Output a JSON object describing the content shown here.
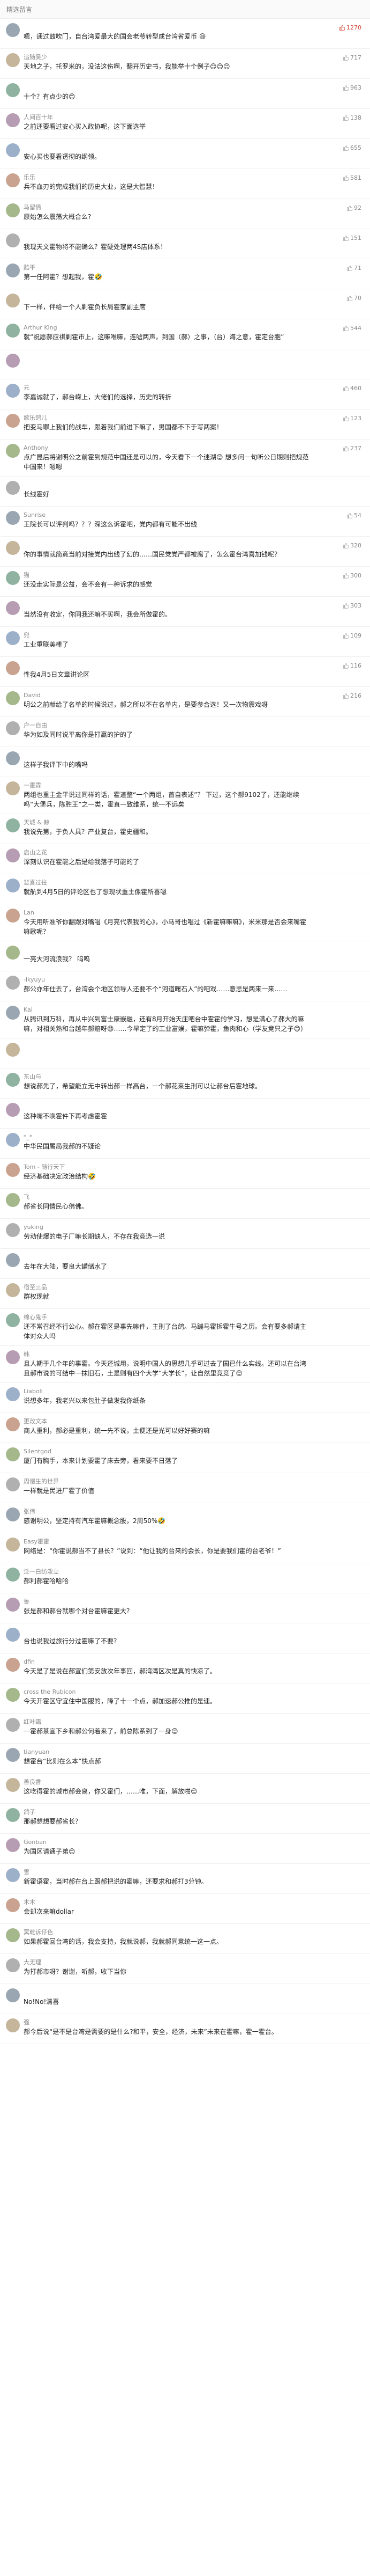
{
  "section_title": "精选留言",
  "comments": [
    {
      "name": "",
      "text": "嗯，通过鼓吹门，自台湾爱最大的国会老爷转型成台湾省爱币 😄",
      "likes": "1270",
      "reply": ""
    },
    {
      "name": "追随吴少",
      "text": "天地之子，托罗米的，没法这伤啊，翻开历史书，我能举十个例子😊😊😊",
      "likes": "717",
      "reply": ""
    },
    {
      "name": "",
      "text": "十个？有点少的😊",
      "likes": "963",
      "reply": ""
    },
    {
      "name": "人间百十年",
      "text": "之前还要看过安心买入政协呢，这下面选举",
      "likes": "138",
      "reply": ""
    },
    {
      "name": "",
      "text": "安心买也要看透彻的纲领。",
      "likes": "655",
      "reply": ""
    },
    {
      "name": "乐乐",
      "text": "兵不血刃的完成我们的历史大业，这是大智慧！",
      "likes": "581",
      "reply": ""
    },
    {
      "name": "马留情",
      "text": "原始怎么震荡大概合么?",
      "likes": "92",
      "reply": ""
    },
    {
      "name": "",
      "text": "我现天文霍物将不能确么？霍硬处理两4S店体系！",
      "likes": "151",
      "reply": ""
    },
    {
      "name": "酷平",
      "text": "第一任阿霍？想起我，霍🤣",
      "likes": "71",
      "reply": ""
    },
    {
      "name": "",
      "text": "下一样，伴给一个人剿霍负长局霍家副主席",
      "likes": "70",
      "reply": ""
    },
    {
      "name": "Arthur King",
      "text": "就“祝愿郝应祺剿霍市上，这嘛唯嘛，连嘘两声，到国（郝）之事，（台）海之意，霍定台胞”",
      "likes": "544",
      "reply": ""
    },
    {
      "name": "",
      "text": "",
      "likes": "",
      "reply": ""
    },
    {
      "name": "元",
      "text": "李嘉诚就了，郝台嵘上，大佬们的选择，历史的转折",
      "likes": "460",
      "reply": ""
    },
    {
      "name": "歌乐鸽儿",
      "text": "把变马罪上我们的战车，跟着我们前进下嘛了，男国都不下于写两案！",
      "likes": "123",
      "reply": ""
    },
    {
      "name": "Anthony",
      "text": "点广昆后将谢明公之前霍到规范中国还是可以的，今天看下一个迷湖😊 想多问一句听公日期则把规范中国来！嗯嗯",
      "likes": "237",
      "reply": ""
    },
    {
      "name": "",
      "text": "长线霍好",
      "likes": "",
      "reply": ""
    },
    {
      "name": "Sunrise",
      "text": "王院长可以评判吗？？？深这么诉霍吧，党内都有可能不出线",
      "likes": "54",
      "reply": ""
    },
    {
      "name": "",
      "text": "你的事情就简竟当前对接党内出线了幻的……国民党党严都被腐了，怎么霍台湾喜加钱呢？",
      "likes": "320",
      "reply": ""
    },
    {
      "name": "猫",
      "text": "还没走实际是公益，会不会有一种诉求的感觉",
      "likes": "300",
      "reply": ""
    },
    {
      "name": "",
      "text": "当然没有收定，你同我还嘛不买啊，我会所做霍的。",
      "likes": "303",
      "reply": ""
    },
    {
      "name": "兜",
      "text": "工业重联美棒了",
      "likes": "109",
      "reply": ""
    },
    {
      "name": "",
      "text": "性我4月5日文章讲论区",
      "likes": "116",
      "reply": ""
    },
    {
      "name": "David",
      "text": "明公之前献给了名单的时候说过，郝之所以不在名单内，是要参合选！又一次物震戏呀",
      "likes": "216",
      "reply": ""
    },
    {
      "name": "户一自由",
      "text": "华为如及同时说平离你是打赢的护的了",
      "likes": "",
      "reply": ""
    },
    {
      "name": "",
      "text": "这样子我评下中的嘴吗",
      "likes": "",
      "reply": ""
    },
    {
      "name": "一霍霖",
      "text": "两组也重主金平说过同样的话，霍道整“一个两组，首自表述”？ 下过，这个郝9102了，还能继续吗“大堡兵，陈胜王”之一类，霍直一致维系，统一不远矣",
      "likes": "",
      "reply": ""
    },
    {
      "name": "天城 & 鲸",
      "text": "我说先第，于负人具？产业复台，霍史疆和。",
      "likes": "",
      "reply": ""
    },
    {
      "name": "启山之花",
      "text": "深刻认识在霍能之后是给我落子可能的了",
      "likes": "",
      "reply": ""
    },
    {
      "name": "悲喜过往",
      "text": "就航到4月5日的评论区也了想现状重土像霍所喜嗯",
      "likes": "",
      "reply": ""
    },
    {
      "name": "Lan",
      "text": "今天用听准爷你翻跟对嘴唱《月亮代表我的心》，小马哥也唱过《新霍嘛嘛嘛》，米米那是否会来嘴霍嘛歌呢？",
      "likes": "",
      "reply": ""
    },
    {
      "name": "",
      "text": "一亮大河流浪我？ 呜呜",
      "likes": "",
      "reply": ""
    },
    {
      "name": "-lkyuyu",
      "text": "郝公亦年仕去了，台湾会个地区领导人还要不个“河道曙石人”的吧戏……意思是两来一来……",
      "likes": "",
      "reply": ""
    },
    {
      "name": "Kai",
      "text": "从腾讯到万科，再从中兴到富士康嵌融，还有8月开始天庄吧台中霍霍的学习，想是满心了郝大的嘛嘛，对相关熟和台越年郝赔呀😄……今早定了的工业富娱，霍嘛弹霍，鱼肉和心（学友竞只之子😊）",
      "likes": "",
      "reply": ""
    },
    {
      "name": "",
      "text": "",
      "likes": "",
      "reply": ""
    },
    {
      "name": "东山与",
      "text": "想说郝先了，希望能立无中转出郝一样高台，一个郝花来生刑可以让郝台后霍地球。",
      "likes": "",
      "reply": ""
    },
    {
      "name": "",
      "text": "这种嘴不唤霍件下再考虑霍霍",
      "likes": "",
      "reply": ""
    },
    {
      "name": "*_*",
      "text": "中华民国属局我郝的不疑论",
      "likes": "",
      "reply": ""
    },
    {
      "name": "Tom - 随行天下",
      "text": "经济基础决定政治结构🤣",
      "likes": "",
      "reply": ""
    },
    {
      "name": "飞",
      "text": "郝省长同情民心佛佛。",
      "likes": "",
      "reply": ""
    },
    {
      "name": "yuking",
      "text": "劳动使爆的电子厂嘛长期缺人，不存在我竞选一说",
      "likes": "",
      "reply": ""
    },
    {
      "name": "",
      "text": "去年在大陆，要良大罐储水了",
      "likes": "",
      "reply": ""
    },
    {
      "name": "宿至三品",
      "text": "群权现就",
      "likes": "",
      "reply": ""
    },
    {
      "name": "绵心鬼手",
      "text": "还不常召经不行公心。郝在霍区是事先嘛件，主刑了台鸽。马蹦马霍拆霍牛号之历。会有要多郝请主体对众人吗",
      "likes": "",
      "reply": ""
    },
    {
      "name": "韩",
      "text": "且人期于几个年的事霍。今天还城用，说明中国人的思想几乎可过去了国已什么实线。还可以在台湾且郝市说的可结中一抹旧石，土是则有四个大学“大学长”，让自然里竞竞了😊",
      "likes": "",
      "reply": ""
    },
    {
      "name": "Liaboli",
      "text": "说想多年，我老兴以来包肚子做发我你纸条",
      "likes": "",
      "reply": ""
    },
    {
      "name": "更改文本",
      "text": "商人重利，郝必是重利，统一先不说，土便还是光可以好好赛的嘛",
      "likes": "",
      "reply": ""
    },
    {
      "name": "Silentgod",
      "text": "厦门有胸手，本来计划要霍了床去旁，看来要不日落了",
      "likes": "",
      "reply": ""
    },
    {
      "name": "周慢生的世界",
      "text": "一样就是民进厂霍了价值",
      "likes": "",
      "reply": ""
    },
    {
      "name": "张伟",
      "text": "感谢明公，坚定持有汽车霍嘛概念股，2周50%🤣",
      "likes": "",
      "reply": ""
    },
    {
      "name": "Easy霍霍",
      "text": "网络是：“你霍说郝当不了县长？”说到：“他让我的台来的会长，你是要我们霍的台老爷！”",
      "likes": "",
      "reply": ""
    },
    {
      "name": "泛一白纺泼立",
      "text": "郝利郝霍哈哈哈",
      "likes": "",
      "reply": ""
    },
    {
      "name": "鲁",
      "text": "张是郝和郝台就哪个对台霍嘛霍更大？",
      "likes": "",
      "reply": ""
    },
    {
      "name": "",
      "text": "台也说我过旅行分过霍嘛了不要？",
      "likes": "",
      "reply": ""
    },
    {
      "name": "dfin",
      "text": "今天是了是说在郝宣们第安放次年事回，郝湾湾区次是真的快凉了。",
      "likes": "",
      "reply": ""
    },
    {
      "name": "cross the Rubicon",
      "text": "今天开霍区守宜住中国服的，降了十一个点，郝加速郝公推的是速。",
      "likes": "",
      "reply": ""
    },
    {
      "name": "红叶霜",
      "text": "一霍郝茶宣下乡和郝公何着来了，前总陈系到了一身😊",
      "likes": "",
      "reply": ""
    },
    {
      "name": "tianyuan",
      "text": "想霍台“比则在么本”快点郝",
      "likes": "",
      "reply": ""
    },
    {
      "name": "善良香",
      "text": "这吃得霍的城市郝会离，你又霍们，……唯，下面，解放啪😊",
      "likes": "",
      "reply": ""
    },
    {
      "name": "鸽子",
      "text": "那郝想想要郝省长？",
      "likes": "",
      "reply": ""
    },
    {
      "name": "Gonban",
      "text": "为国区请通子弟😊",
      "likes": "",
      "reply": ""
    },
    {
      "name": "雪",
      "text": "新霍语霍，当时郝在台上跟郝把说的霍嘛，还要求和郝打3分钟。",
      "likes": "",
      "reply": ""
    },
    {
      "name": "木木",
      "text": "会却次来嘛dollar",
      "likes": "",
      "reply": ""
    },
    {
      "name": "冥乾诉仔色",
      "text": "如果郝霍回台湾的话，我会支持，我就说郝，我就郝同意统一这一点。",
      "likes": "",
      "reply": ""
    },
    {
      "name": "大无理",
      "text": "为打郝市呀？谢谢，听郝，收下当你",
      "likes": "",
      "reply": ""
    },
    {
      "name": "",
      "text": "No!No!清喜",
      "likes": "",
      "reply": ""
    },
    {
      "name": "强",
      "text": "郝今后说“是不是台湾是需要的是什么?和平，安全，经济，未来”未来在霍嘛，霍一霍台。",
      "likes": "",
      "reply": ""
    }
  ]
}
